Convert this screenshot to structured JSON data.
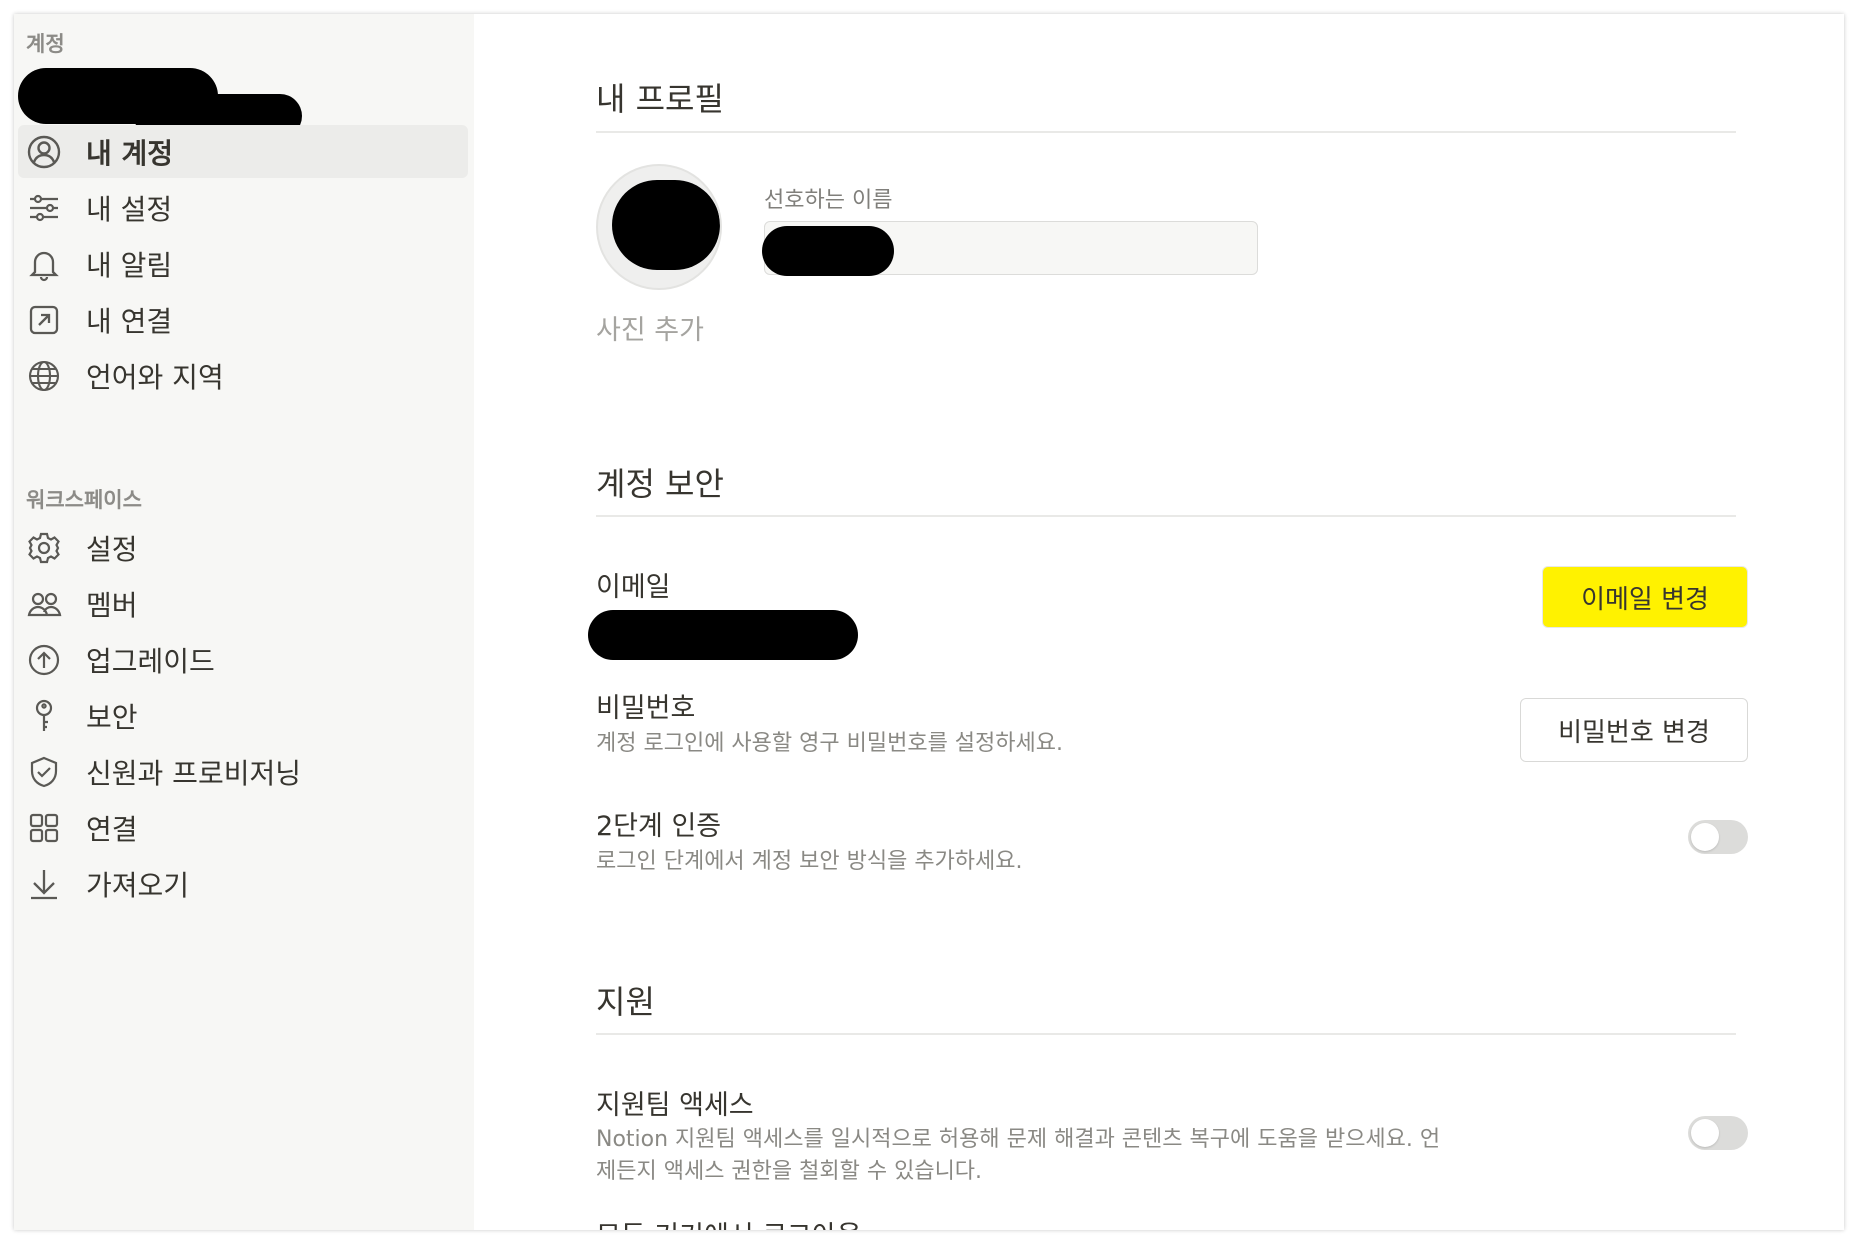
{
  "sidebar": {
    "account_section_label": "계정",
    "account_items": [
      {
        "label": "내 계정",
        "icon": "user-circle-icon",
        "active": true
      },
      {
        "label": "내 설정",
        "icon": "sliders-icon"
      },
      {
        "label": "내 알림",
        "icon": "bell-icon"
      },
      {
        "label": "내 연결",
        "icon": "external-link-icon"
      },
      {
        "label": "언어와 지역",
        "icon": "globe-icon"
      }
    ],
    "workspace_section_label": "워크스페이스",
    "workspace_items": [
      {
        "label": "설정",
        "icon": "gear-icon"
      },
      {
        "label": "멤버",
        "icon": "members-icon"
      },
      {
        "label": "업그레이드",
        "icon": "upgrade-icon"
      },
      {
        "label": "보안",
        "icon": "key-icon"
      },
      {
        "label": "신원과 프로비저닝",
        "icon": "shield-check-icon"
      },
      {
        "label": "연결",
        "icon": "grid-icon"
      },
      {
        "label": "가져오기",
        "icon": "download-icon"
      }
    ]
  },
  "profile": {
    "title": "내 프로필",
    "add_photo_label": "사진 추가",
    "preferred_name_label": "선호하는 이름"
  },
  "security": {
    "title": "계정 보안",
    "email": {
      "label": "이메일",
      "button": "이메일 변경"
    },
    "password": {
      "label": "비밀번호",
      "description": "계정 로그인에 사용할 영구 비밀번호를 설정하세요.",
      "button": "비밀번호 변경"
    },
    "two_factor": {
      "label": "2단계 인증",
      "description": "로그인 단계에서 계정 보안 방식을 추가하세요.",
      "enabled": false
    }
  },
  "support": {
    "title": "지원",
    "support_access": {
      "label": "지원팀 액세스",
      "description_line1": "Notion 지원팀 액세스를 일시적으로 허용해 문제 해결과 콘텐츠 복구에 도움을 받으세요. 언",
      "description_line2": "제든지 액세스 권한을 철회할 수 있습니다.",
      "enabled": false
    },
    "next_item_partial": "모든 기기에서 로그아웃"
  },
  "colors": {
    "highlight": "#fff200",
    "active_bg": "#ececea",
    "sidebar_bg": "#f7f7f5"
  }
}
